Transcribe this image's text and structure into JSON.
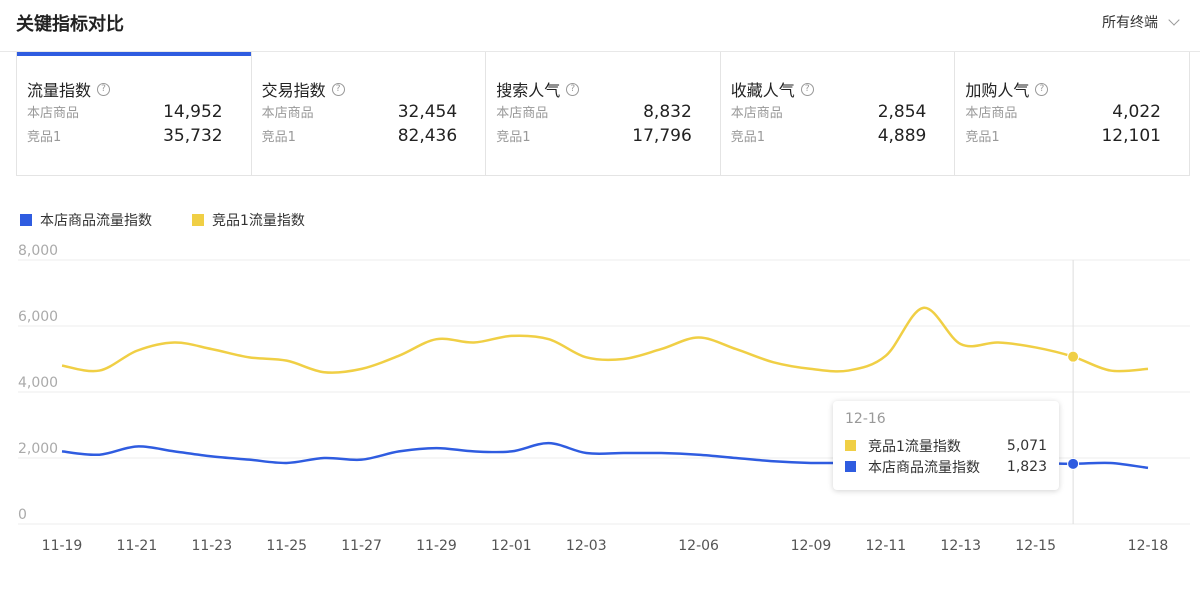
{
  "header": {
    "title": "关键指标对比",
    "terminal_select": "所有终端"
  },
  "cards": [
    {
      "name": "流量指数",
      "rows": [
        {
          "label": "本店商品",
          "value": "14,952"
        },
        {
          "label": "竞品1",
          "value": "35,732"
        }
      ]
    },
    {
      "name": "交易指数",
      "rows": [
        {
          "label": "本店商品",
          "value": "32,454"
        },
        {
          "label": "竞品1",
          "value": "82,436"
        }
      ]
    },
    {
      "name": "搜索人气",
      "rows": [
        {
          "label": "本店商品",
          "value": "8,832"
        },
        {
          "label": "竞品1",
          "value": "17,796"
        }
      ]
    },
    {
      "name": "收藏人气",
      "rows": [
        {
          "label": "本店商品",
          "value": "2,854"
        },
        {
          "label": "竞品1",
          "value": "4,889"
        }
      ]
    },
    {
      "name": "加购人气",
      "rows": [
        {
          "label": "本店商品",
          "value": "4,022"
        },
        {
          "label": "竞品1",
          "value": "12,101"
        }
      ]
    }
  ],
  "help_glyph": "?",
  "tooltip": {
    "date": "12-16",
    "rows": [
      {
        "name": "竞品1流量指数",
        "value": "5,071",
        "color": "#f0cf45"
      },
      {
        "name": "本店商品流量指数",
        "value": "1,823",
        "color": "#2f5ce0"
      }
    ]
  },
  "chart_data": {
    "type": "line",
    "x": [
      "11-19",
      "11-20",
      "11-21",
      "11-22",
      "11-23",
      "11-24",
      "11-25",
      "11-26",
      "11-27",
      "11-28",
      "11-29",
      "11-30",
      "12-01",
      "12-02",
      "12-03",
      "12-04",
      "12-05",
      "12-06",
      "12-07",
      "12-08",
      "12-09",
      "12-10",
      "12-11",
      "12-12",
      "12-13",
      "12-14",
      "12-15",
      "12-16",
      "12-17",
      "12-18"
    ],
    "x_ticks": [
      "11-19",
      "11-21",
      "11-23",
      "11-25",
      "11-27",
      "11-29",
      "12-01",
      "12-03",
      "12-06",
      "12-09",
      "12-11",
      "12-13",
      "12-15",
      "12-18"
    ],
    "y_ticks": [
      "0",
      "2,000",
      "4,000",
      "6,000",
      "8,000"
    ],
    "ylim": [
      0,
      8000
    ],
    "series": [
      {
        "name": "本店商品流量指数",
        "color": "#2f5ce0",
        "values": [
          2200,
          2100,
          2350,
          2200,
          2050,
          1950,
          1850,
          2000,
          1950,
          2200,
          2300,
          2200,
          2200,
          2450,
          2150,
          2150,
          2150,
          2100,
          2000,
          1900,
          1850,
          1850,
          1850,
          1850,
          1850,
          1850,
          1850,
          1823,
          1850,
          1700
        ]
      },
      {
        "name": "竞品1流量指数",
        "color": "#f0cf45",
        "values": [
          4800,
          4650,
          5250,
          5500,
          5300,
          5050,
          4950,
          4600,
          4700,
          5100,
          5600,
          5500,
          5700,
          5600,
          5050,
          5000,
          5300,
          5650,
          5300,
          4900,
          4700,
          4650,
          5100,
          6550,
          5450,
          5500,
          5350,
          5071,
          4650,
          4700
        ]
      }
    ],
    "highlight_index": 27,
    "grid": true,
    "legend": "top-left"
  }
}
